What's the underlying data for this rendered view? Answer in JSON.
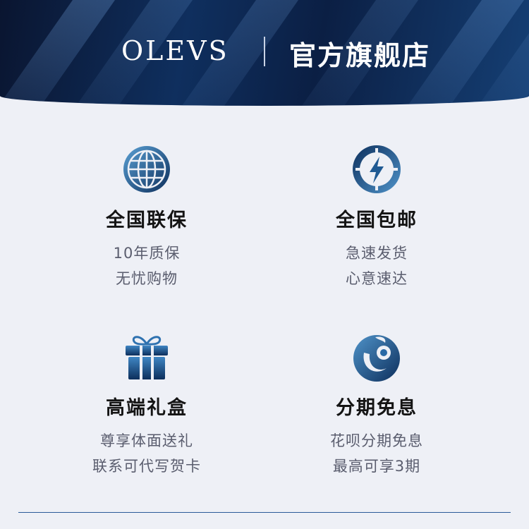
{
  "header": {
    "brand": "OLEVS",
    "store_title": "官方旗舰店"
  },
  "features": [
    {
      "icon": "globe-icon",
      "title": "全国联保",
      "line1": "10年质保",
      "line2": "无忧购物"
    },
    {
      "icon": "lightning-icon",
      "title": "全国包邮",
      "line1": "急速发货",
      "line2": "心意速达"
    },
    {
      "icon": "gift-icon",
      "title": "高端礼盒",
      "line1": "尊享体面送礼",
      "line2": "联系可代写贺卡"
    },
    {
      "icon": "installment-logo-icon",
      "title": "分期免息",
      "line1": "花呗分期免息",
      "line2": "最高可享3期"
    }
  ],
  "colors": {
    "banner_dark": "#0a1530",
    "icon_dark": "#0d2f5c",
    "icon_light": "#4f93c9"
  }
}
